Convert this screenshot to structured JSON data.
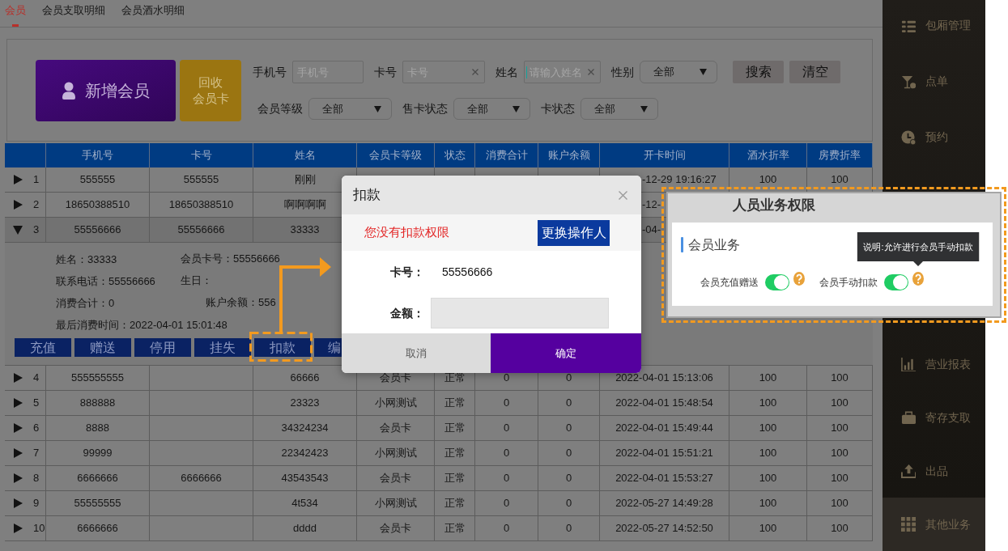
{
  "tabs": [
    {
      "label": "会员",
      "selected": true
    },
    {
      "label": "会员支取明细",
      "selected": false
    },
    {
      "label": "会员酒水明细",
      "selected": false
    }
  ],
  "toolbar": {
    "add_button": "新增会员",
    "recycle_button": [
      "回收",
      "会员卡"
    ]
  },
  "filters": [
    [
      {
        "kind": "input",
        "label": "手机号",
        "placeholder": "手机号",
        "clearable": false,
        "focused": false
      },
      {
        "kind": "input",
        "label": "卡号",
        "placeholder": "卡号",
        "clearable": true,
        "focused": false
      },
      {
        "kind": "input",
        "label": "姓名",
        "placeholder": "请输入姓名",
        "clearable": true,
        "focused": true
      },
      {
        "kind": "select",
        "label": "性别",
        "value": "全部"
      }
    ],
    [
      {
        "kind": "select",
        "label": "会员等级",
        "value": "全部"
      },
      {
        "kind": "select",
        "label": "售卡状态",
        "value": "全部"
      },
      {
        "kind": "select",
        "label": "卡状态",
        "value": "全部"
      }
    ]
  ],
  "filter_buttons": [
    "搜索",
    "清空"
  ],
  "table": {
    "columns": [
      "手机号",
      "卡号",
      "姓名",
      "会员卡等级",
      "状态",
      "消费合计",
      "账户余额",
      "开卡时间",
      "酒水折率",
      "房费折率"
    ],
    "rows": [
      {
        "number": "1",
        "expanded": false,
        "time_cut": true,
        "cells": [
          "555555",
          "555555",
          "刚刚",
          null,
          null,
          null,
          null,
          "-12-29 19:16:27",
          "100",
          "100"
        ]
      },
      {
        "number": "2",
        "expanded": false,
        "time_cut": true,
        "cells": [
          "18650388510",
          "18650388510",
          "啊啊啊啊",
          null,
          null,
          null,
          null,
          "-12-",
          null,
          null
        ]
      },
      {
        "number": "3",
        "expanded": true,
        "time_cut": true,
        "cells": [
          "55556666",
          "55556666",
          "33333",
          null,
          null,
          null,
          null,
          "-04-",
          null,
          null
        ],
        "detail": {
          "info": [
            [
              "姓名：33333",
              "会员卡号：55556666"
            ],
            [
              "联系电话：55556666",
              "生日："
            ],
            [
              "消费合计：0",
              "账户余额：556"
            ],
            [
              "最后消费时间：2022-04-01 15:01:48"
            ]
          ],
          "actions": [
            {
              "label": "充值",
              "highlighted": false
            },
            {
              "label": "赠送",
              "highlighted": false
            },
            {
              "label": "停用",
              "highlighted": false
            },
            {
              "label": "挂失",
              "highlighted": false
            },
            {
              "label": "扣款",
              "highlighted": true
            },
            {
              "label": "编",
              "highlighted": false,
              "cut": true
            }
          ]
        }
      },
      {
        "number": "4",
        "expanded": false,
        "cells": [
          "555555555",
          null,
          "66666",
          "会员卡",
          "正常",
          "0",
          "0",
          "2022-04-01 15:13:06",
          "100",
          "100"
        ]
      },
      {
        "number": "5",
        "expanded": false,
        "cells": [
          "888888",
          null,
          "23323",
          "小网测试",
          "正常",
          "0",
          "0",
          "2022-04-01 15:48:54",
          "100",
          "100"
        ]
      },
      {
        "number": "6",
        "expanded": false,
        "cells": [
          "8888",
          null,
          "34324234",
          "会员卡",
          "正常",
          "0",
          "0",
          "2022-04-01 15:49:44",
          "100",
          "100"
        ]
      },
      {
        "number": "7",
        "expanded": false,
        "cells": [
          "99999",
          null,
          "22342423",
          "小网测试",
          "正常",
          "0",
          "0",
          "2022-04-01 15:51:21",
          "100",
          "100"
        ]
      },
      {
        "number": "8",
        "expanded": false,
        "cells": [
          "6666666",
          "6666666",
          "43543543",
          "会员卡",
          "正常",
          "0",
          "0",
          "2022-04-01 15:53:27",
          "100",
          "100"
        ]
      },
      {
        "number": "9",
        "expanded": false,
        "cells": [
          "55555555",
          null,
          "4t534",
          "小网测试",
          "正常",
          "0",
          "0",
          "2022-05-27 14:49:28",
          "100",
          "100"
        ]
      },
      {
        "number": "10",
        "expanded": false,
        "cells": [
          "6666666",
          null,
          "dddd",
          "会员卡",
          "正常",
          "0",
          "0",
          "2022-05-27 14:52:50",
          "100",
          "100"
        ]
      }
    ]
  },
  "modal": {
    "title": "扣款",
    "warning": "您没有扣款权限",
    "switch_button": "更换操作人",
    "fields": [
      {
        "kind": "text",
        "label": "卡号：",
        "value": "55556666"
      },
      {
        "kind": "input",
        "label": "金额："
      }
    ],
    "buttons": [
      {
        "kind": "secondary",
        "label": "取消"
      },
      {
        "kind": "primary",
        "label": "确定"
      }
    ]
  },
  "sidebar": {
    "upper_items": [
      {
        "label": "包厢管理",
        "selected": false
      },
      {
        "label": "点单",
        "selected": false
      },
      {
        "label": "预约",
        "selected": false
      }
    ],
    "lower_items": [
      {
        "label": "营业报表",
        "selected": false
      },
      {
        "label": "寄存支取",
        "selected": false
      },
      {
        "label": "出品",
        "selected": false
      },
      {
        "label": "其他业务",
        "selected": true
      }
    ]
  },
  "permission_panel": {
    "title": "人员业务权限",
    "section": "会员业务",
    "permissions": [
      {
        "label": "会员充值赠送",
        "on": true
      },
      {
        "label": "会员手动扣款",
        "on": true,
        "tooltip": "说明:允许进行会员手动扣款"
      }
    ]
  }
}
